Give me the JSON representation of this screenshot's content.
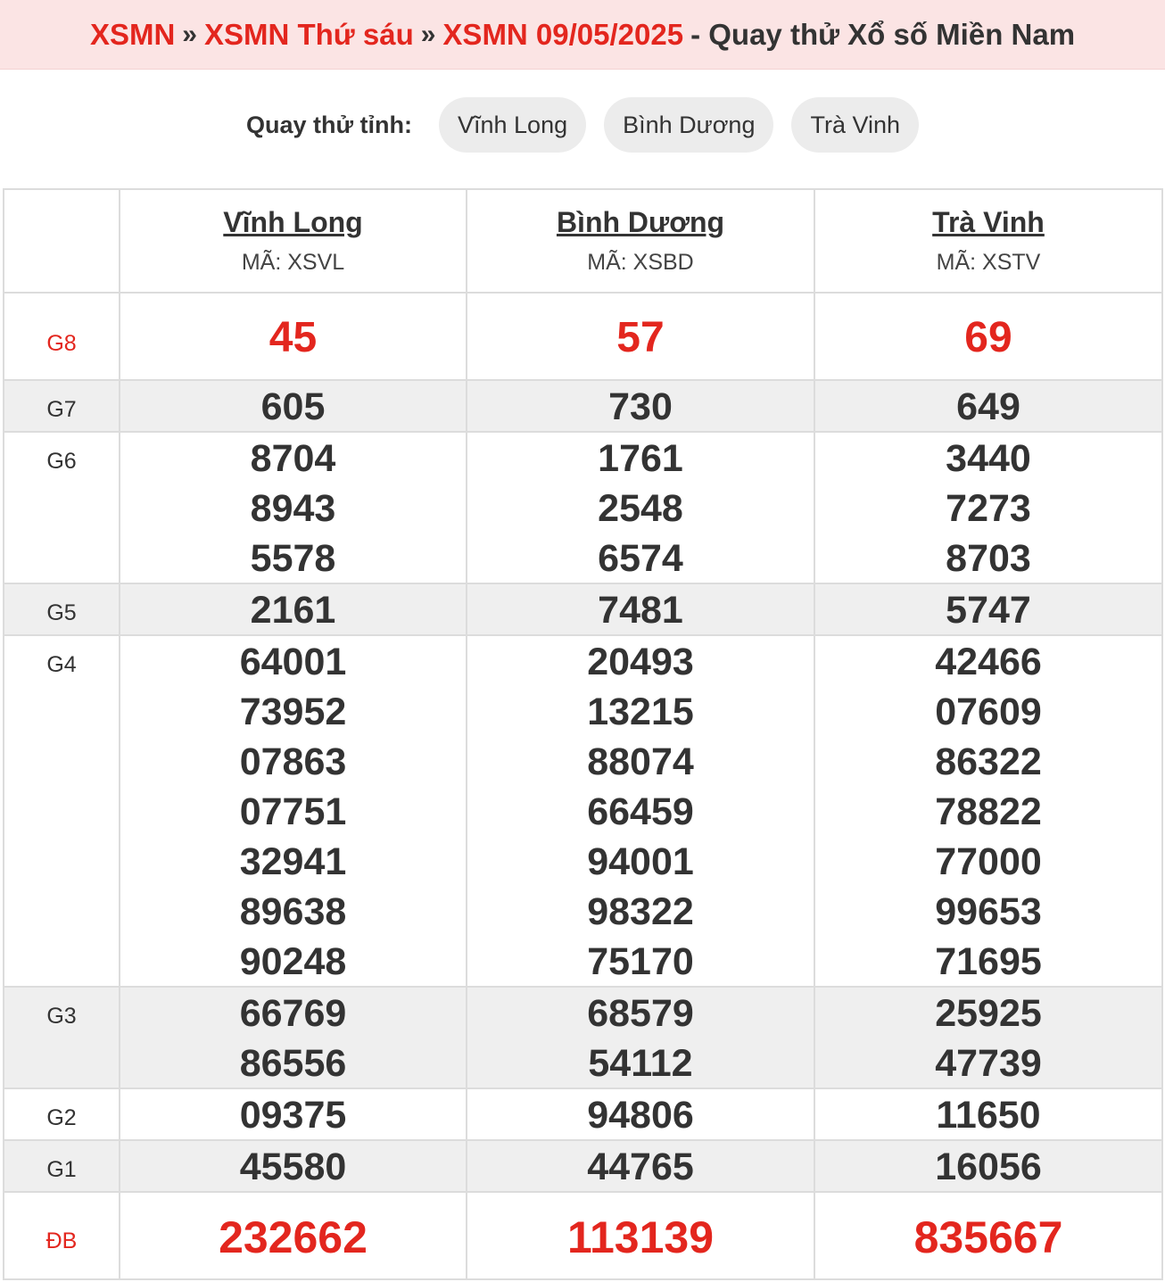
{
  "breadcrumb": {
    "item1": "XSMN",
    "item2": "XSMN Thứ sáu",
    "item3": "XSMN 09/05/2025",
    "separator": "»",
    "suffix": "- Quay thử Xổ số Miền Nam"
  },
  "picker": {
    "label": "Quay thử tỉnh:",
    "options": [
      "Vĩnh Long",
      "Bình Dương",
      "Trà Vinh"
    ]
  },
  "provinces": [
    {
      "name": "Vĩnh Long",
      "code": "MÃ: XSVL"
    },
    {
      "name": "Bình Dương",
      "code": "MÃ: XSBD"
    },
    {
      "name": "Trà Vinh",
      "code": "MÃ: XSTV"
    }
  ],
  "prizes": {
    "labels": {
      "g8": "G8",
      "g7": "G7",
      "g6": "G6",
      "g5": "G5",
      "g4": "G4",
      "g3": "G3",
      "g2": "G2",
      "g1": "G1",
      "db": "ĐB"
    },
    "g8": [
      [
        "45"
      ],
      [
        "57"
      ],
      [
        "69"
      ]
    ],
    "g7": [
      [
        "605"
      ],
      [
        "730"
      ],
      [
        "649"
      ]
    ],
    "g6": [
      [
        "8704",
        "8943",
        "5578"
      ],
      [
        "1761",
        "2548",
        "6574"
      ],
      [
        "3440",
        "7273",
        "8703"
      ]
    ],
    "g5": [
      [
        "2161"
      ],
      [
        "7481"
      ],
      [
        "5747"
      ]
    ],
    "g4": [
      [
        "64001",
        "73952",
        "07863",
        "07751",
        "32941",
        "89638",
        "90248"
      ],
      [
        "20493",
        "13215",
        "88074",
        "66459",
        "94001",
        "98322",
        "75170"
      ],
      [
        "42466",
        "07609",
        "86322",
        "78822",
        "77000",
        "99653",
        "71695"
      ]
    ],
    "g3": [
      [
        "66769",
        "86556"
      ],
      [
        "68579",
        "54112"
      ],
      [
        "25925",
        "47739"
      ]
    ],
    "g2": [
      [
        "09375"
      ],
      [
        "94806"
      ],
      [
        "11650"
      ]
    ],
    "g1": [
      [
        "45580"
      ],
      [
        "44765"
      ],
      [
        "16056"
      ]
    ],
    "db": [
      [
        "232662"
      ],
      [
        "113139"
      ],
      [
        "835667"
      ]
    ]
  },
  "colors": {
    "accent": "#e3261e",
    "header_bg": "#fbe4e4",
    "alt_row": "#efefef",
    "pill": "#ececec"
  }
}
